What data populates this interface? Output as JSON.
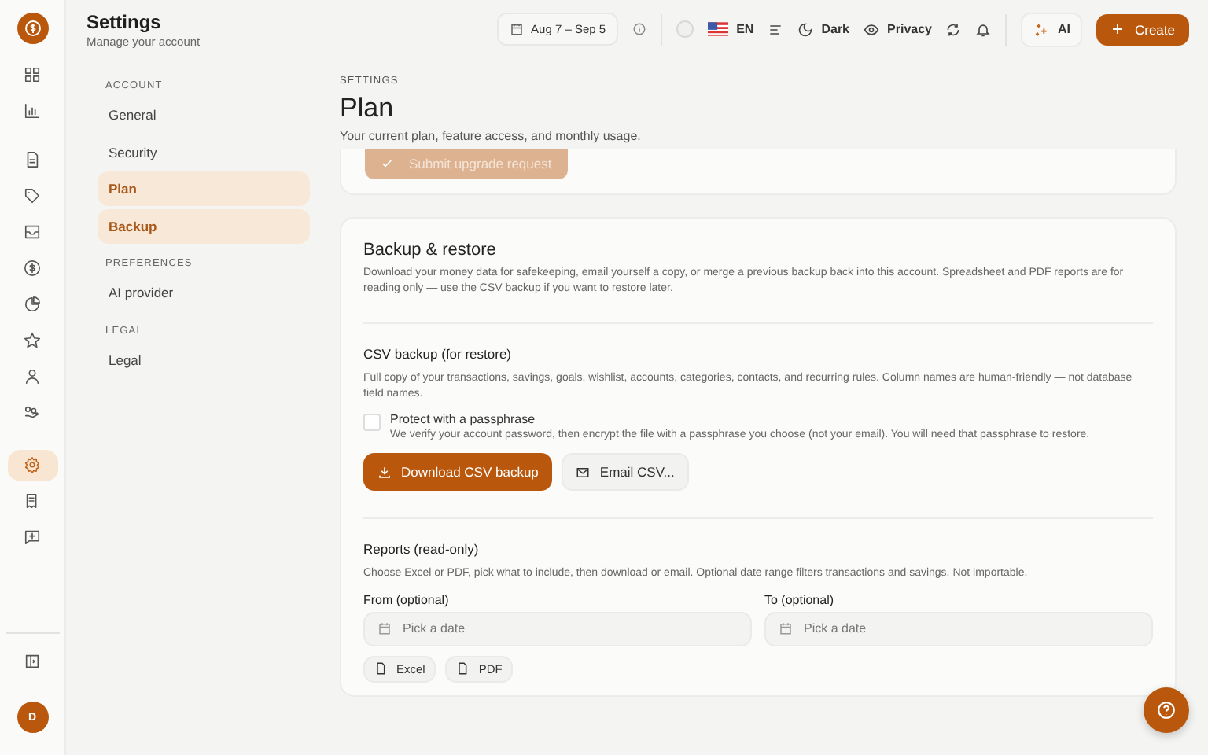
{
  "header": {
    "title": "Settings",
    "subtitle": "Manage your account",
    "date_range": "Aug 7 – Sep 5",
    "language": "EN",
    "theme": "Dark",
    "privacy": "Privacy",
    "ai": "AI",
    "create": "Create"
  },
  "rail": [
    {
      "selected": false
    },
    {
      "selected": false
    },
    {
      "selected": false
    },
    {
      "selected": false
    },
    {
      "selected": false
    },
    {
      "selected": false
    },
    {
      "selected": false
    },
    {
      "selected": false
    },
    {
      "selected": false
    },
    {
      "selected": false
    },
    {
      "selected": true
    },
    {
      "selected": false
    },
    {
      "selected": false
    }
  ],
  "avatar": "D",
  "settings_nav": [
    {
      "heading": "ACCOUNT",
      "items": [
        {
          "label": "General",
          "selected": false
        },
        {
          "label": "Security",
          "selected": false
        },
        {
          "label": "Plan",
          "selected": true
        },
        {
          "label": "Backup",
          "selected": true
        }
      ]
    },
    {
      "heading": "PREFERENCES",
      "items": [
        {
          "label": "AI provider",
          "selected": false
        }
      ]
    },
    {
      "heading": "LEGAL",
      "items": [
        {
          "label": "Legal",
          "selected": false
        }
      ]
    }
  ],
  "page": {
    "eyebrow": "SETTINGS",
    "title": "Plan",
    "subtitle": "Your current plan, feature access, and monthly usage.",
    "upgrade_button": "Submit upgrade request"
  },
  "backup": {
    "title": "Backup & restore",
    "description": "Download your money data for safekeeping, email yourself a copy, or merge a previous backup back into this account. Spreadsheet and PDF reports are for reading only — use the CSV backup if you want to restore later.",
    "csv": {
      "title": "CSV backup (for restore)",
      "description": "Full copy of your transactions, savings, goals, wishlist, accounts, categories, contacts, and recurring rules. Column names are human-friendly — not database field names.",
      "passphrase": {
        "label": "Protect with a passphrase",
        "hint": "We verify your account password, then encrypt the file with a passphrase you choose (not your email). You will need that passphrase to restore.",
        "checked": false
      },
      "download_button": "Download CSV backup",
      "email_button": "Email CSV..."
    },
    "reports": {
      "title": "Reports (read-only)",
      "description": "Choose Excel or PDF, pick what to include, then download or email. Optional date range filters transactions and savings. Not importable.",
      "from": {
        "label": "From (optional)",
        "placeholder": "Pick a date"
      },
      "to": {
        "label": "To (optional)",
        "placeholder": "Pick a date"
      },
      "formats": [
        "Excel",
        "PDF"
      ]
    }
  }
}
